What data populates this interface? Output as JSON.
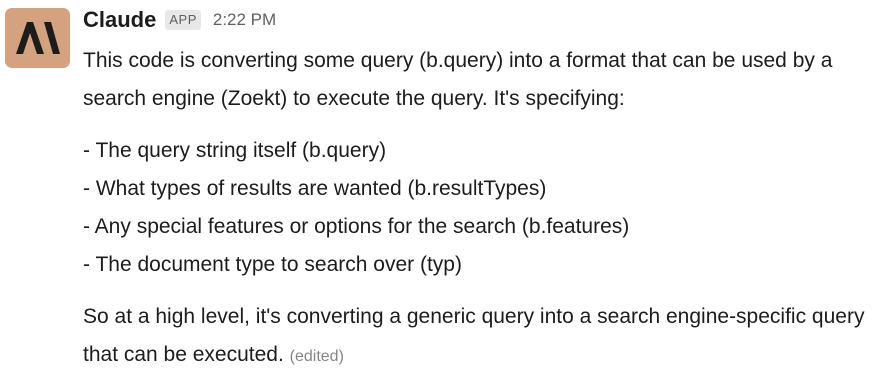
{
  "message": {
    "sender": "Claude",
    "badge": "APP",
    "timestamp": "2:22 PM",
    "avatar_color": "#d4a27f",
    "avatar_icon": "anthropic-logo-icon",
    "intro": "This code is converting some query (b.query) into a format that can be used by a search engine (Zoekt) to execute the query. It's specifying:",
    "list": [
      "- The query string itself (b.query)",
      "- What types of results are wanted (b.resultTypes)",
      "- Any special features or options for the search (b.features)",
      "- The document type to search over (typ)"
    ],
    "closing": "So at a high level, it's converting a generic query into a search engine-specific query that can be executed.",
    "edited_label": "(edited)"
  }
}
